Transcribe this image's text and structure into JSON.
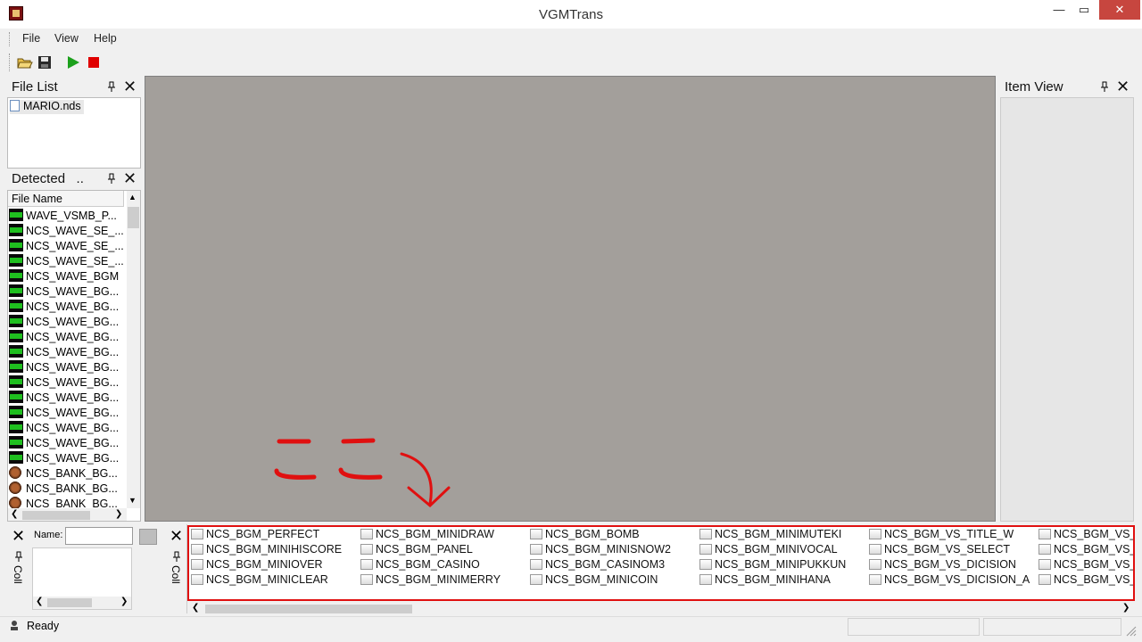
{
  "window": {
    "title": "VGMTrans",
    "minimize": "—",
    "maximize": "▭",
    "close": "✕"
  },
  "menu": [
    "File",
    "View",
    "Help"
  ],
  "toolbar": {
    "open_icon": "open-folder-icon",
    "save_icon": "save-icon",
    "play_icon": "play-icon",
    "stop_icon": "stop-icon"
  },
  "file_list": {
    "title": "File List",
    "pin": "📌",
    "close": "✕",
    "items": [
      "MARIO.nds"
    ]
  },
  "detected": {
    "title": "Detected   ..",
    "column": "File Name",
    "items": [
      {
        "name": "WAVE_VSMB_P...",
        "icon": "wave"
      },
      {
        "name": "NCS_WAVE_SE_...",
        "icon": "wave"
      },
      {
        "name": "NCS_WAVE_SE_...",
        "icon": "wave"
      },
      {
        "name": "NCS_WAVE_SE_...",
        "icon": "wave"
      },
      {
        "name": "NCS_WAVE_BGM",
        "icon": "wave"
      },
      {
        "name": "NCS_WAVE_BG...",
        "icon": "wave"
      },
      {
        "name": "NCS_WAVE_BG...",
        "icon": "wave"
      },
      {
        "name": "NCS_WAVE_BG...",
        "icon": "wave"
      },
      {
        "name": "NCS_WAVE_BG...",
        "icon": "wave"
      },
      {
        "name": "NCS_WAVE_BG...",
        "icon": "wave"
      },
      {
        "name": "NCS_WAVE_BG...",
        "icon": "wave"
      },
      {
        "name": "NCS_WAVE_BG...",
        "icon": "wave"
      },
      {
        "name": "NCS_WAVE_BG...",
        "icon": "wave"
      },
      {
        "name": "NCS_WAVE_BG...",
        "icon": "wave"
      },
      {
        "name": "NCS_WAVE_BG...",
        "icon": "wave"
      },
      {
        "name": "NCS_WAVE_BG...",
        "icon": "wave"
      },
      {
        "name": "NCS_WAVE_BG...",
        "icon": "wave"
      },
      {
        "name": "NCS_BANK_BG...",
        "icon": "bank"
      },
      {
        "name": "NCS_BANK_BG...",
        "icon": "bank"
      },
      {
        "name": "NCS_BANK_BG...",
        "icon": "bank"
      }
    ]
  },
  "item_view": {
    "title": "Item View"
  },
  "coll_panel": {
    "name_label": "Name:",
    "vertical_label": "Coll"
  },
  "collections": {
    "vertical_label": "Coll",
    "columns": [
      [
        "NCS_BGM_PERFECT",
        "NCS_BGM_MINIHISCORE",
        "NCS_BGM_MINIOVER",
        "NCS_BGM_MINICLEAR"
      ],
      [
        "NCS_BGM_MINIDRAW",
        "NCS_BGM_PANEL",
        "NCS_BGM_CASINO",
        "NCS_BGM_MINIMERRY"
      ],
      [
        "NCS_BGM_BOMB",
        "NCS_BGM_MINISNOW2",
        "NCS_BGM_CASINOM3",
        "NCS_BGM_MINICOIN"
      ],
      [
        "NCS_BGM_MINIMUTEKI",
        "NCS_BGM_MINIVOCAL",
        "NCS_BGM_MINIPUKKUN",
        "NCS_BGM_MINIHANA"
      ],
      [
        "NCS_BGM_VS_TITLE_W",
        "NCS_BGM_VS_SELECT",
        "NCS_BGM_VS_DICISION",
        "NCS_BGM_VS_DICISION_A"
      ],
      [
        "NCS_BGM_VS_",
        "NCS_BGM_VS_",
        "NCS_BGM_VS_",
        "NCS_BGM_VS_"
      ]
    ]
  },
  "annotation": {
    "text": "ここ"
  },
  "status": {
    "text": "Ready"
  },
  "colors": {
    "highlight": "#e01010",
    "mdi_bg": "#a39f9b"
  }
}
